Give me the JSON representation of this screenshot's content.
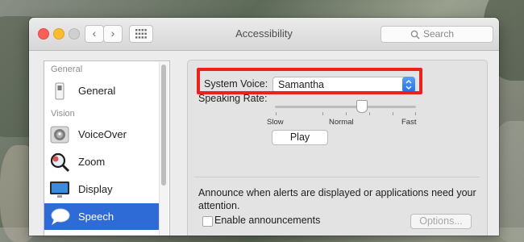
{
  "window": {
    "title": "Accessibility"
  },
  "toolbar": {
    "back_glyph": "‹",
    "forward_glyph": "›",
    "grid_icon": "grid-icon",
    "search_placeholder": "Search"
  },
  "sidebar": {
    "sections": [
      {
        "label": "General"
      },
      {
        "label": "Vision"
      }
    ],
    "items": [
      {
        "label": "General",
        "icon": "general-switch-icon",
        "selected": false
      },
      {
        "label": "VoiceOver",
        "icon": "voiceover-icon",
        "selected": false
      },
      {
        "label": "Zoom",
        "icon": "zoom-magnifier-icon",
        "selected": false
      },
      {
        "label": "Display",
        "icon": "display-monitor-icon",
        "selected": false
      },
      {
        "label": "Speech",
        "icon": "speech-bubble-icon",
        "selected": true
      }
    ]
  },
  "speech": {
    "system_voice_label": "System Voice:",
    "system_voice_value": "Samantha",
    "speaking_rate_label": "Speaking Rate:",
    "rate_slow": "Slow",
    "rate_normal": "Normal",
    "rate_fast": "Fast",
    "rate_value": 0.61,
    "play_label": "Play",
    "announce_text_line1": "Announce when alerts are displayed or applications need your",
    "announce_text_line2": "attention.",
    "enable_announcements_label": "Enable announcements",
    "enable_announcements_checked": false,
    "options_label": "Options..."
  },
  "colors": {
    "highlight": "#e8231b",
    "selection": "#2f6bd6",
    "close": "#fc5f57",
    "minimize": "#fdbc2e",
    "zoom_disabled": "#cfcfcf"
  }
}
